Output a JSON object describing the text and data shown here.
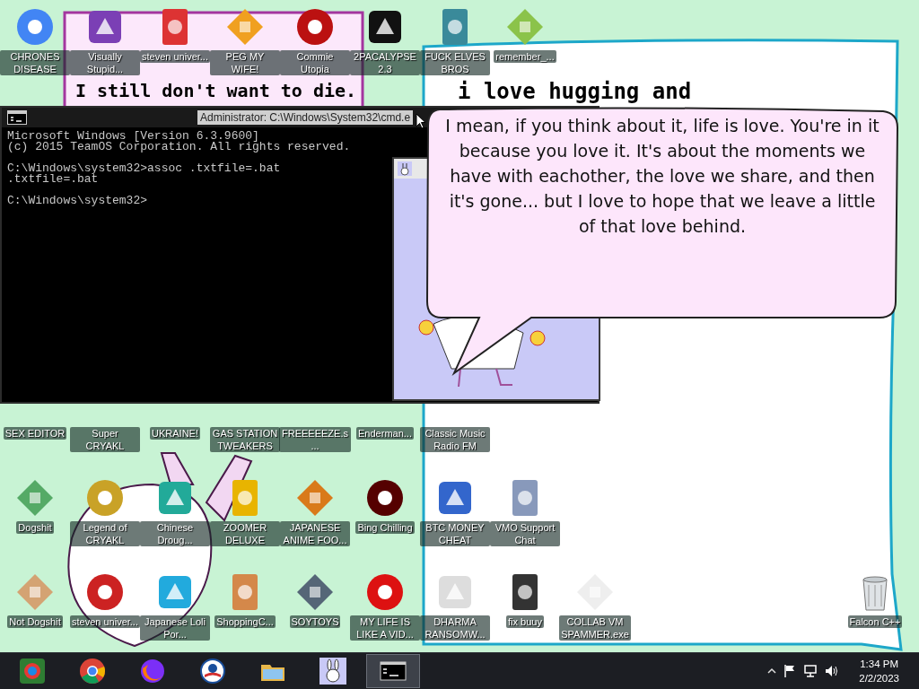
{
  "wallpaper": {
    "captions": [
      "I still don't want to die.",
      "i love hugging and"
    ]
  },
  "desktop_icons": {
    "rows": [
      [
        "CHRONES DISEASE",
        "Visually Stupid...",
        "steven univer...",
        "PEG MY WIFE!",
        "Commie Utopia",
        "2PACALYPSE 2.3",
        "FUCK ELVES BROS",
        "remember_..."
      ],
      [
        "SEX EDITOR",
        "Super CRYAKL",
        "UKRAINE!",
        "GAS STATION TWEAKERS",
        "FREEEEEZE.s...",
        "Enderman...",
        "Classic Music Radio FM"
      ],
      [
        "Dogshit",
        "Legend of CRYAKL",
        "Chinese Droug...",
        "ZOOMER DELUXE",
        "JAPANESE ANIME FOO...",
        "Bing Chilling",
        "BTC MONEY CHEAT",
        "VMO Support Chat"
      ],
      [
        "Not Dogshit",
        "steven univer...",
        "Japanese Loli Por...",
        "ShoppingC...",
        "SOYTOYS",
        "MY LIFE IS LIKE A VID...",
        "DHARMA RANSOMW...",
        "fix buuy",
        "COLLAB VM SPAMMER.exe"
      ]
    ],
    "corner_icon": "Falcon C++"
  },
  "cmd_window": {
    "title": "Administrator: C:\\Windows\\System32\\cmd.e",
    "blocks": [
      [
        "Microsoft Windows [Version 6.3.9600]",
        "(c) 2015 TeamOS Corporation. All rights reserved."
      ],
      [
        "C:\\Windows\\system32>assoc .txtfile=.bat",
        ".txtfile=.bat"
      ],
      [
        "C:\\Windows\\system32>"
      ]
    ]
  },
  "speech_bubble": {
    "text": "I mean, if you think about it, life is love. You're in it because you love it. It's about the moments we have with eachother, the love we share, and then it's gone... but I love to hope that we leave a little of that love behind."
  },
  "taskbar": {
    "buttons": [
      {
        "selected": false
      },
      {
        "selected": false
      },
      {
        "selected": false
      },
      {
        "selected": false
      },
      {
        "selected": false
      },
      {
        "selected": false
      },
      {
        "selected": true
      }
    ],
    "clock": {
      "time": "1:34 PM",
      "date": "2/2/2023"
    }
  }
}
